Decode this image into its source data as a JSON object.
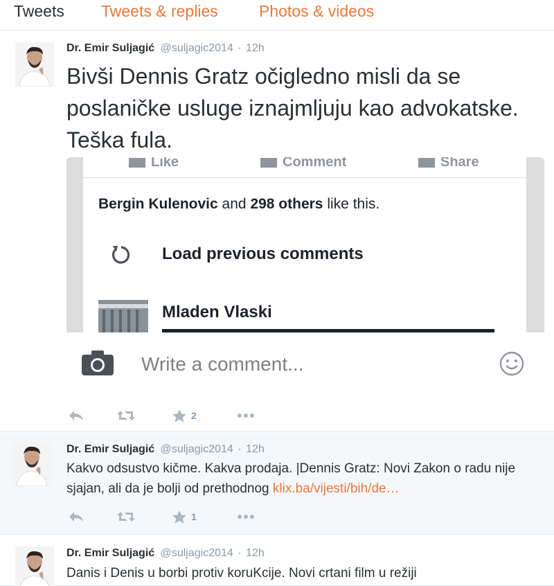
{
  "tabs": [
    {
      "label": "Tweets"
    },
    {
      "label": "Tweets & replies"
    },
    {
      "label": "Photos & videos"
    }
  ],
  "colors": {
    "accent": "#e8783a",
    "text": "#292f33",
    "muted": "#8899a6",
    "divider": "#e1e8ed"
  },
  "tweets": [
    {
      "name": "Dr. Emir Suljagić",
      "handle": "@suljagic2014",
      "dot": "·",
      "time": "12h",
      "text": "Bivši Dennis Gratz očigledno misli da se poslaničke usluge iznajmljuju kao advokatske. Teška fula.",
      "media": {
        "fb_actions": [
          "Like",
          "Comment",
          "Share"
        ],
        "likes_name": "Bergin Kulenovic",
        "likes_and": "and",
        "likes_count": "298 others",
        "likes_suffix": "like this.",
        "load_previous": "Load previous comments",
        "commenter": "Mladen Vlaski",
        "write_placeholder": "Write a comment..."
      },
      "favorites": "2",
      "icons": [
        "reply-icon",
        "retweet-icon",
        "favorite-icon",
        "more-icon"
      ]
    },
    {
      "name": "Dr. Emir Suljagić",
      "handle": "@suljagic2014",
      "dot": "·",
      "time": "12h",
      "text": "Kakvo odsustvo kičme. Kakva prodaja. |Dennis Gratz: Novi Zakon o radu nije sjajan, ali da je bolji od prethodnog",
      "link": "klix.ba/vijesti/bih/de…",
      "favorites": "1",
      "icons": [
        "reply-icon",
        "retweet-icon",
        "favorite-icon",
        "more-icon"
      ]
    },
    {
      "name": "Dr. Emir Suljagić",
      "handle": "@suljagic2014",
      "dot": "·",
      "time": "12h",
      "text": "Danis i Denis u borbi protiv koruKcije. Novi crtani film u režiji"
    }
  ]
}
